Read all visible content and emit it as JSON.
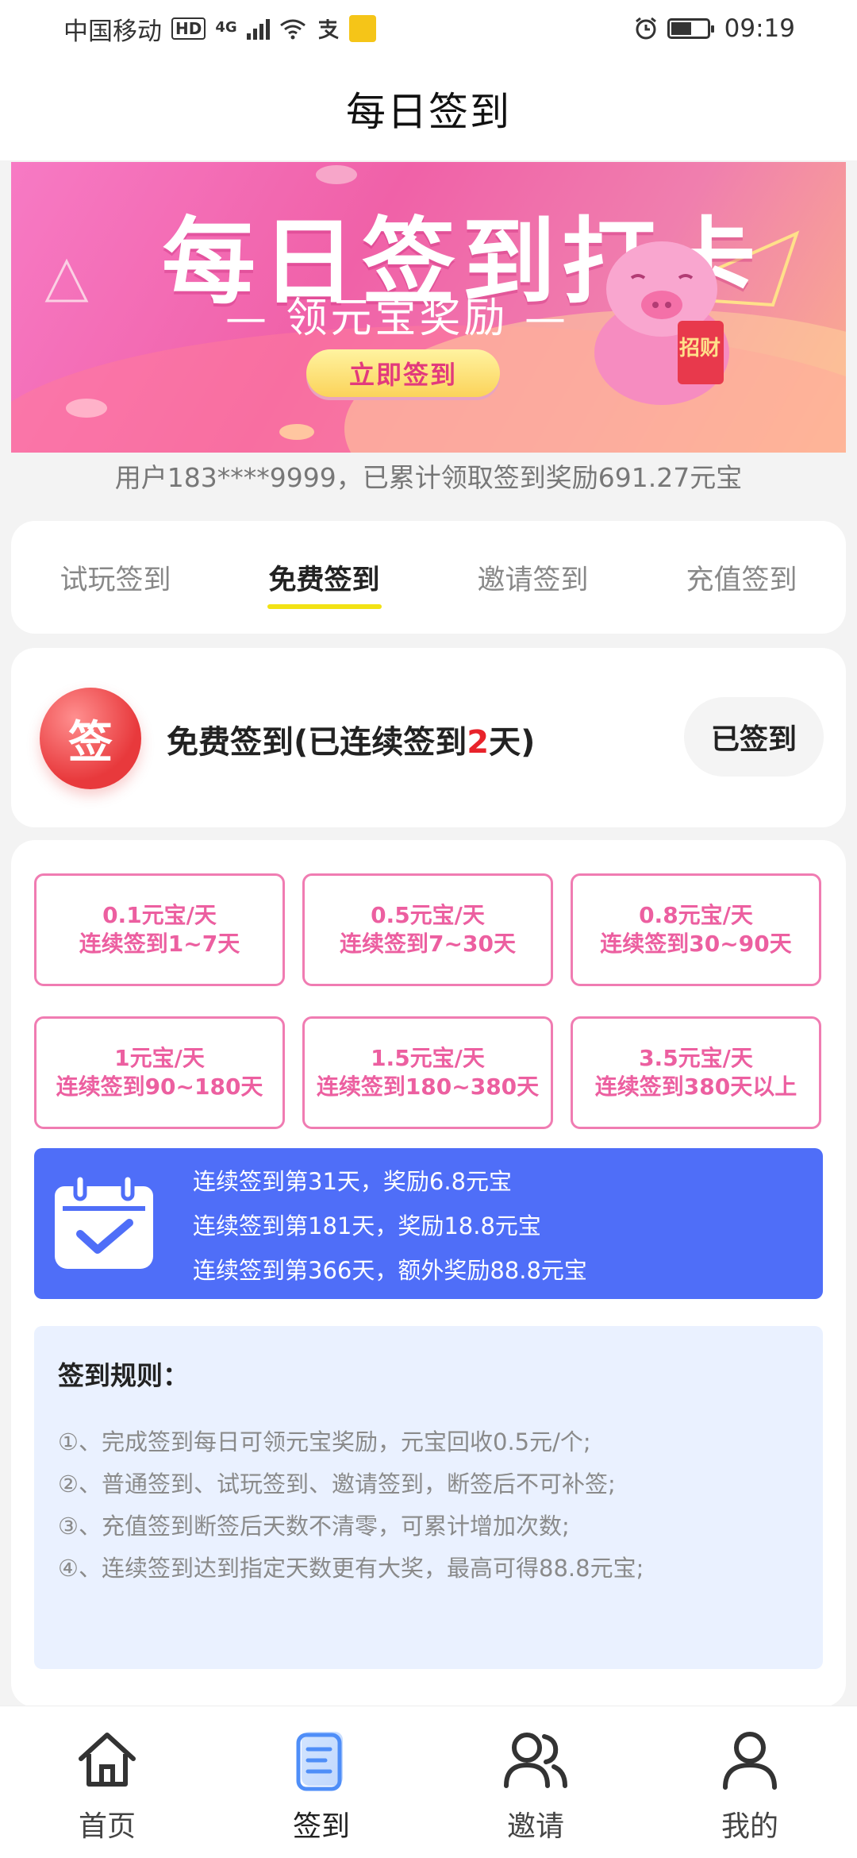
{
  "status_bar": {
    "carrier": "中国移动",
    "hd": "HD",
    "network": "4G",
    "time": "09:19"
  },
  "header": {
    "title": "每日签到"
  },
  "banner": {
    "title": "每日签到打卡",
    "subtitle": "— 领元宝奖励 —",
    "button_label": "立即签到",
    "pig_sign": "招财"
  },
  "cumulative_text": "用户183****9999，已累计领取签到奖励691.27元宝",
  "tabs": [
    {
      "label": "试玩签到",
      "active": false
    },
    {
      "label": "免费签到",
      "active": true
    },
    {
      "label": "邀请签到",
      "active": false
    },
    {
      "label": "充值签到",
      "active": false
    }
  ],
  "checkin": {
    "logo_char": "签",
    "prefix": "免费签到(已连续签到",
    "days": "2",
    "suffix": "天)",
    "button_label": "已签到"
  },
  "rewards": [
    {
      "rate": "0.1元宝/天",
      "range": "连续签到1~7天"
    },
    {
      "rate": "0.5元宝/天",
      "range": "连续签到7~30天"
    },
    {
      "rate": "0.8元宝/天",
      "range": "连续签到30~90天"
    },
    {
      "rate": "1元宝/天",
      "range": "连续签到90~180天"
    },
    {
      "rate": "1.5元宝/天",
      "range": "连续签到180~380天"
    },
    {
      "rate": "3.5元宝/天",
      "range": "连续签到380天以上"
    }
  ],
  "bonus": [
    "连续签到第31天，奖励6.8元宝",
    "连续签到第181天，奖励18.8元宝",
    "连续签到第366天，额外奖励88.8元宝"
  ],
  "rules": {
    "title": "签到规则：",
    "items": [
      "①、完成签到每日可领元宝奖励，元宝回收0.5元/个;",
      "②、普通签到、试玩签到、邀请签到，断签后不可补签;",
      "③、充值签到断签后天数不清零，可累计增加次数;",
      "④、连续签到达到指定天数更有大奖，最高可得88.8元宝;"
    ]
  },
  "nav": [
    {
      "label": "首页",
      "icon": "home-icon"
    },
    {
      "label": "签到",
      "icon": "checkin-icon"
    },
    {
      "label": "邀请",
      "icon": "invite-icon"
    },
    {
      "label": "我的",
      "icon": "profile-icon"
    }
  ],
  "colors": {
    "accent_pink": "#ec5fa0",
    "bonus_blue": "#4f6ef8",
    "tab_underline": "#f2e214",
    "days_red": "#e8232b"
  }
}
